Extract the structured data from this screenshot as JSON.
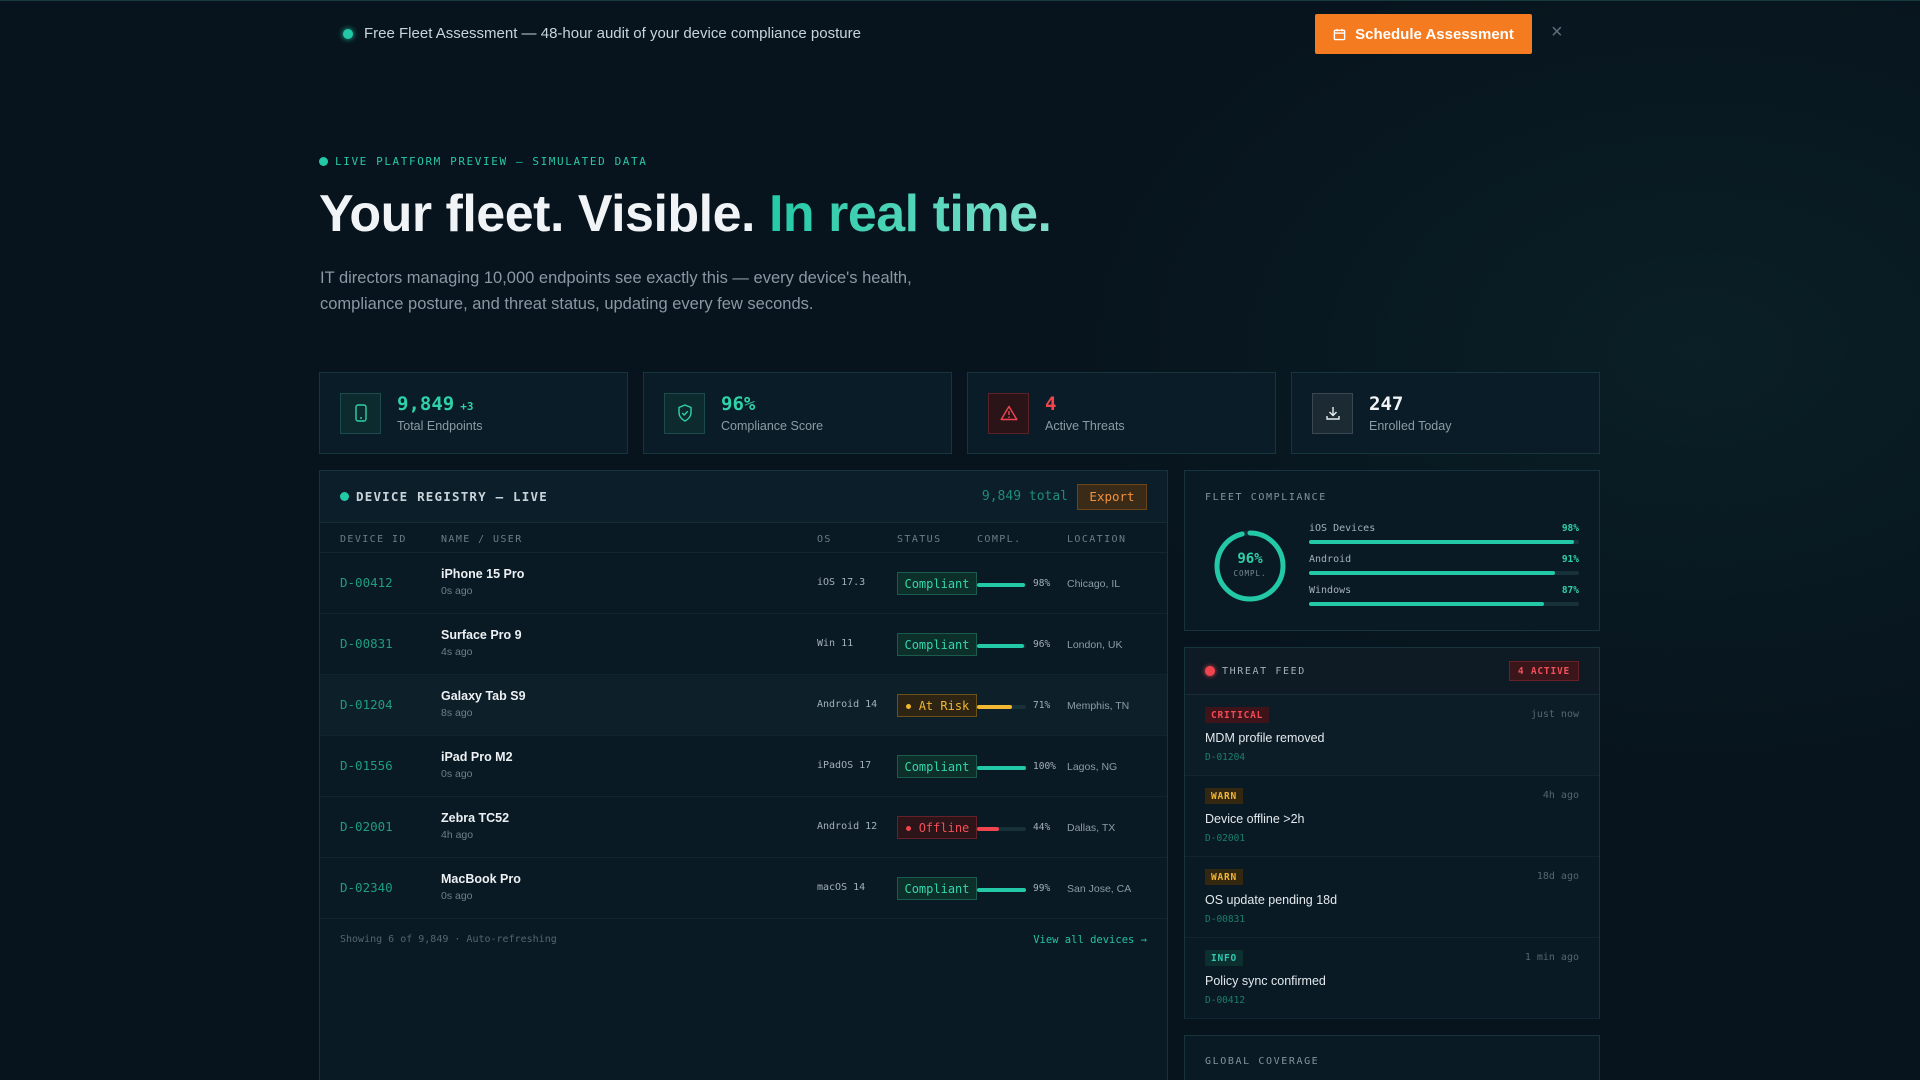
{
  "banner": {
    "text": "Free Fleet Assessment — 48-hour audit of your device compliance posture",
    "cta_label": "Schedule Assessment",
    "close_glyph": "×",
    "cta_color": "#f47b1f"
  },
  "hero": {
    "eyebrow": "LIVE PLATFORM PREVIEW — SIMULATED DATA",
    "title_main": "Your fleet. Visible. ",
    "title_accent": "In real time.",
    "subtitle": "IT directors managing 10,000 endpoints see exactly this — every device's health, compliance posture, and threat status, updating every few seconds."
  },
  "stats": [
    {
      "value": "9,849",
      "delta": "+3",
      "label": "Total Endpoints",
      "icon": "phone-icon",
      "color": "#2fd1a8"
    },
    {
      "value": "96%",
      "label": "Compliance Score",
      "icon": "shield-check-icon",
      "color": "#2fd1a8"
    },
    {
      "value": "4",
      "label": "Active Threats",
      "icon": "warning-triangle-icon",
      "color": "#f0454f"
    },
    {
      "value": "247",
      "label": "Enrolled Today",
      "icon": "download-icon",
      "color": "#f1f4f6"
    }
  ],
  "registry": {
    "title": "DEVICE REGISTRY — LIVE",
    "total": "9,849 total",
    "export_label": "Export",
    "columns": [
      "DEVICE ID",
      "NAME / USER",
      "OS",
      "STATUS",
      "COMPL.",
      "LOCATION"
    ],
    "rows": [
      {
        "id": "D-00412",
        "name": "iPhone 15 Pro",
        "ago": "0s ago",
        "os": "iOS 17.3",
        "status": "Compliant",
        "state": "ok",
        "compliance": 98,
        "pct": "98%",
        "location": "Chicago, IL"
      },
      {
        "id": "D-00831",
        "name": "Surface Pro 9",
        "ago": "4s ago",
        "os": "Win 11",
        "status": "Compliant",
        "state": "ok",
        "compliance": 96,
        "pct": "96%",
        "location": "London, UK"
      },
      {
        "id": "D-01204",
        "name": "Galaxy Tab S9",
        "ago": "8s ago",
        "os": "Android 14",
        "status": "At Risk",
        "state": "risk",
        "compliance": 71,
        "pct": "71%",
        "location": "Memphis, TN"
      },
      {
        "id": "D-01556",
        "name": "iPad Pro M2",
        "ago": "0s ago",
        "os": "iPadOS 17",
        "status": "Compliant",
        "state": "ok",
        "compliance": 100,
        "pct": "100%",
        "location": "Lagos, NG"
      },
      {
        "id": "D-02001",
        "name": "Zebra TC52",
        "ago": "4h ago",
        "os": "Android 12",
        "status": "Offline",
        "state": "off",
        "compliance": 44,
        "pct": "44%",
        "location": "Dallas, TX"
      },
      {
        "id": "D-02340",
        "name": "MacBook Pro",
        "ago": "0s ago",
        "os": "macOS 14",
        "status": "Compliant",
        "state": "ok",
        "compliance": 99,
        "pct": "99%",
        "location": "San Jose, CA"
      }
    ],
    "footer_text": "Showing 6 of 9,849 · Auto-refreshing",
    "view_all": "View all devices →"
  },
  "compliance": {
    "label": "FLEET COMPLIANCE",
    "ring_value": 96,
    "ring_pct": "96%",
    "ring_sub": "COMPL.",
    "bars": [
      {
        "name": "iOS Devices",
        "value": 98,
        "pct": "98%"
      },
      {
        "name": "Android",
        "value": 91,
        "pct": "91%"
      },
      {
        "name": "Windows",
        "value": 87,
        "pct": "87%"
      }
    ]
  },
  "threats": {
    "label": "THREAT FEED",
    "active": "4 ACTIVE",
    "items": [
      {
        "severity": "CRITICAL",
        "level": "crit",
        "time": "just now",
        "message": "MDM profile removed",
        "device": "D-01204"
      },
      {
        "severity": "WARN",
        "level": "warn",
        "time": "4h ago",
        "message": "Device offline >2h",
        "device": "D-02001"
      },
      {
        "severity": "WARN",
        "level": "warn",
        "time": "18d ago",
        "message": "OS update pending 18d",
        "device": "D-00831"
      },
      {
        "severity": "INFO",
        "level": "info",
        "time": "1 min ago",
        "message": "Policy sync confirmed",
        "device": "D-00412"
      }
    ]
  },
  "coverage": {
    "label": "GLOBAL COVERAGE"
  }
}
